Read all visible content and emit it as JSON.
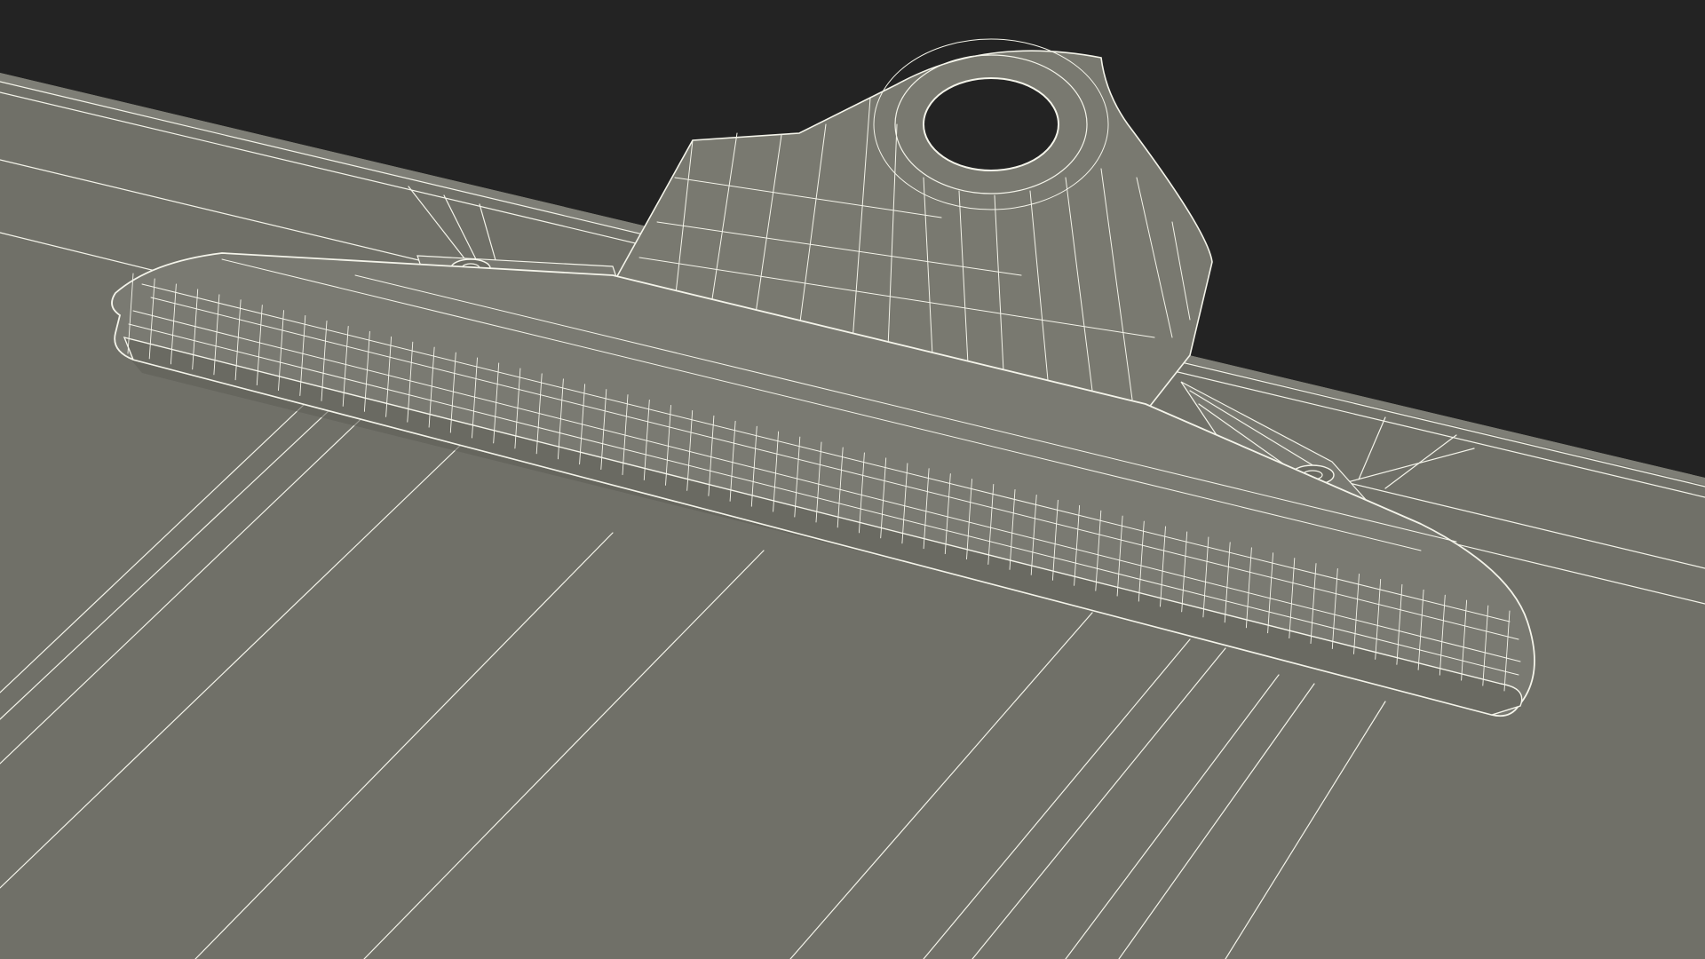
{
  "scene": {
    "subject": "clipboard-clip-wireframe-render",
    "colors": {
      "background": "#232323",
      "board": "#707068",
      "board_shadow": "#5f5f58",
      "clip_top": "#7b7b72",
      "clip_face": "#6c6c64",
      "wire": "#f4f4ea"
    }
  }
}
